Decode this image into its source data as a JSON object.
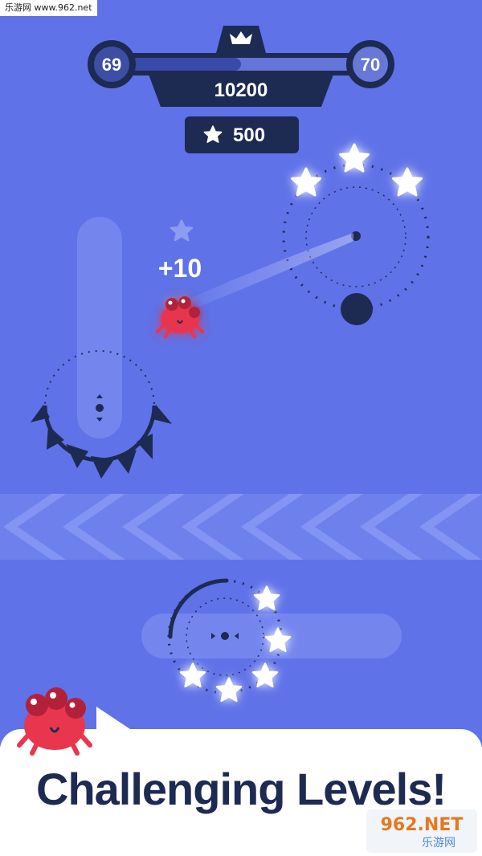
{
  "watermark_top": "乐游网 www.962.net",
  "hud": {
    "level_current": "69",
    "level_next": "70",
    "score": "10200",
    "stars": "500",
    "progress": 0.5
  },
  "popup": {
    "points": "+10"
  },
  "banner": {
    "title": "Challenging Levels!"
  },
  "watermark_bottom": {
    "brand": "962.NET",
    "sub": "乐游网"
  },
  "colors": {
    "background": "#5f72e8",
    "dark_navy": "#1d2a52",
    "crab_red": "#e8364f",
    "star_glow": "#ffffff"
  },
  "icons": [
    "crown-icon",
    "star-icon",
    "crab-character",
    "spiked-wheel",
    "chevron-left-icon"
  ]
}
